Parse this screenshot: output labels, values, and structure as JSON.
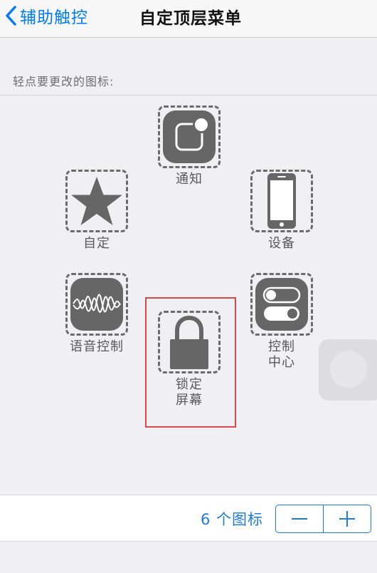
{
  "navbar": {
    "back_label": "辅助触控",
    "title": "自定顶层菜单"
  },
  "section_header": "轻点要更改的图标:",
  "slots": {
    "notification": {
      "label": "通知",
      "icon": "notification-icon"
    },
    "custom": {
      "label": "自定",
      "icon": "star-icon"
    },
    "device": {
      "label": "设备",
      "icon": "iphone-icon"
    },
    "voice_control": {
      "label": "语音控制",
      "icon": "waveform-icon"
    },
    "lock_screen": {
      "label_line1": "锁定",
      "label_line2": "屏幕",
      "icon": "lock-icon"
    },
    "control_center": {
      "label_line1": "控制",
      "label_line2": "中心",
      "icon": "toggles-icon"
    }
  },
  "bottom": {
    "count_label": "6 个图标",
    "decrement_icon": "minus-icon",
    "increment_icon": "plus-icon"
  },
  "colors": {
    "accent": "#007aff",
    "stepper_blue": "#1f7ae0",
    "icon_gray": "#666666",
    "highlight_red": "#d84848",
    "background": "#efeff4"
  }
}
